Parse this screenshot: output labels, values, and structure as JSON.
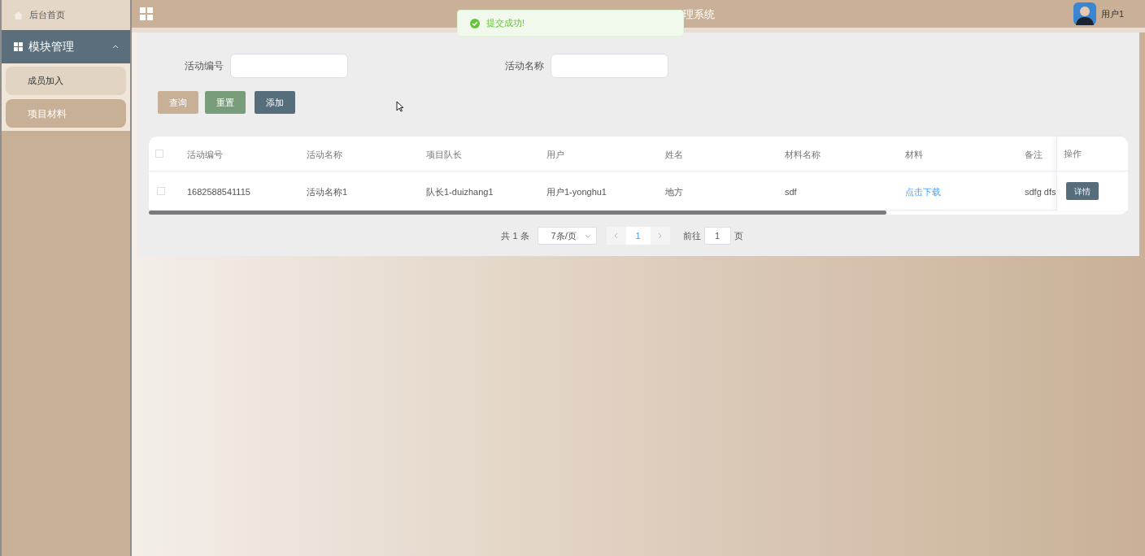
{
  "sidebar": {
    "home": {
      "label": "后台首页"
    },
    "menu": {
      "label": "模块管理",
      "expanded": true,
      "items": [
        {
          "label": "成员加入",
          "selected": false
        },
        {
          "label": "项目材料",
          "selected": true
        }
      ]
    }
  },
  "header": {
    "title": "理系统",
    "user": "用户1"
  },
  "toast": {
    "message": "提交成功!"
  },
  "search": {
    "fields": [
      {
        "label": "活动编号"
      },
      {
        "label": "活动名称"
      }
    ],
    "buttons": [
      {
        "label": "查询",
        "kind": "query"
      },
      {
        "label": "重置",
        "kind": "reset"
      },
      {
        "label": "添加",
        "kind": "add"
      }
    ]
  },
  "table": {
    "header_checked": false,
    "columns": [
      "活动编号",
      "活动名称",
      "项目队长",
      "用户",
      "姓名",
      "材料名称",
      "材料",
      "备注",
      "操作"
    ],
    "rows": [
      {
        "checked": false,
        "cells": [
          "1682588541115",
          "活动名称1",
          "队长1-duizhang1",
          "用户1-yonghu1",
          "地方",
          "sdf",
          "点击下载",
          "sdfg dfs"
        ],
        "action": "详情"
      }
    ]
  },
  "pagination": {
    "total": "共 1 条",
    "page_size": "7条/页",
    "pages": [
      {
        "label": "1",
        "selected": true
      }
    ],
    "goto_label": "前往",
    "goto_value": "1",
    "page_suffix": "页"
  }
}
